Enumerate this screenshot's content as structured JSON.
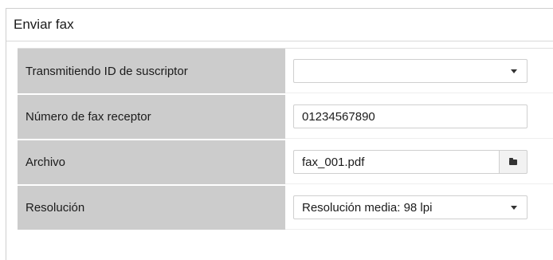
{
  "panel": {
    "title": "Enviar fax"
  },
  "form": {
    "subscriber_id": {
      "label": "Transmitiendo ID de suscriptor",
      "value": ""
    },
    "receiver_number": {
      "label": "Número de fax receptor",
      "value": "01234567890"
    },
    "file": {
      "label": "Archivo",
      "value": "fax_001.pdf",
      "button_icon": "folder-icon"
    },
    "resolution": {
      "label": "Resolución",
      "value": "Resolución media: 98 lpi"
    }
  }
}
